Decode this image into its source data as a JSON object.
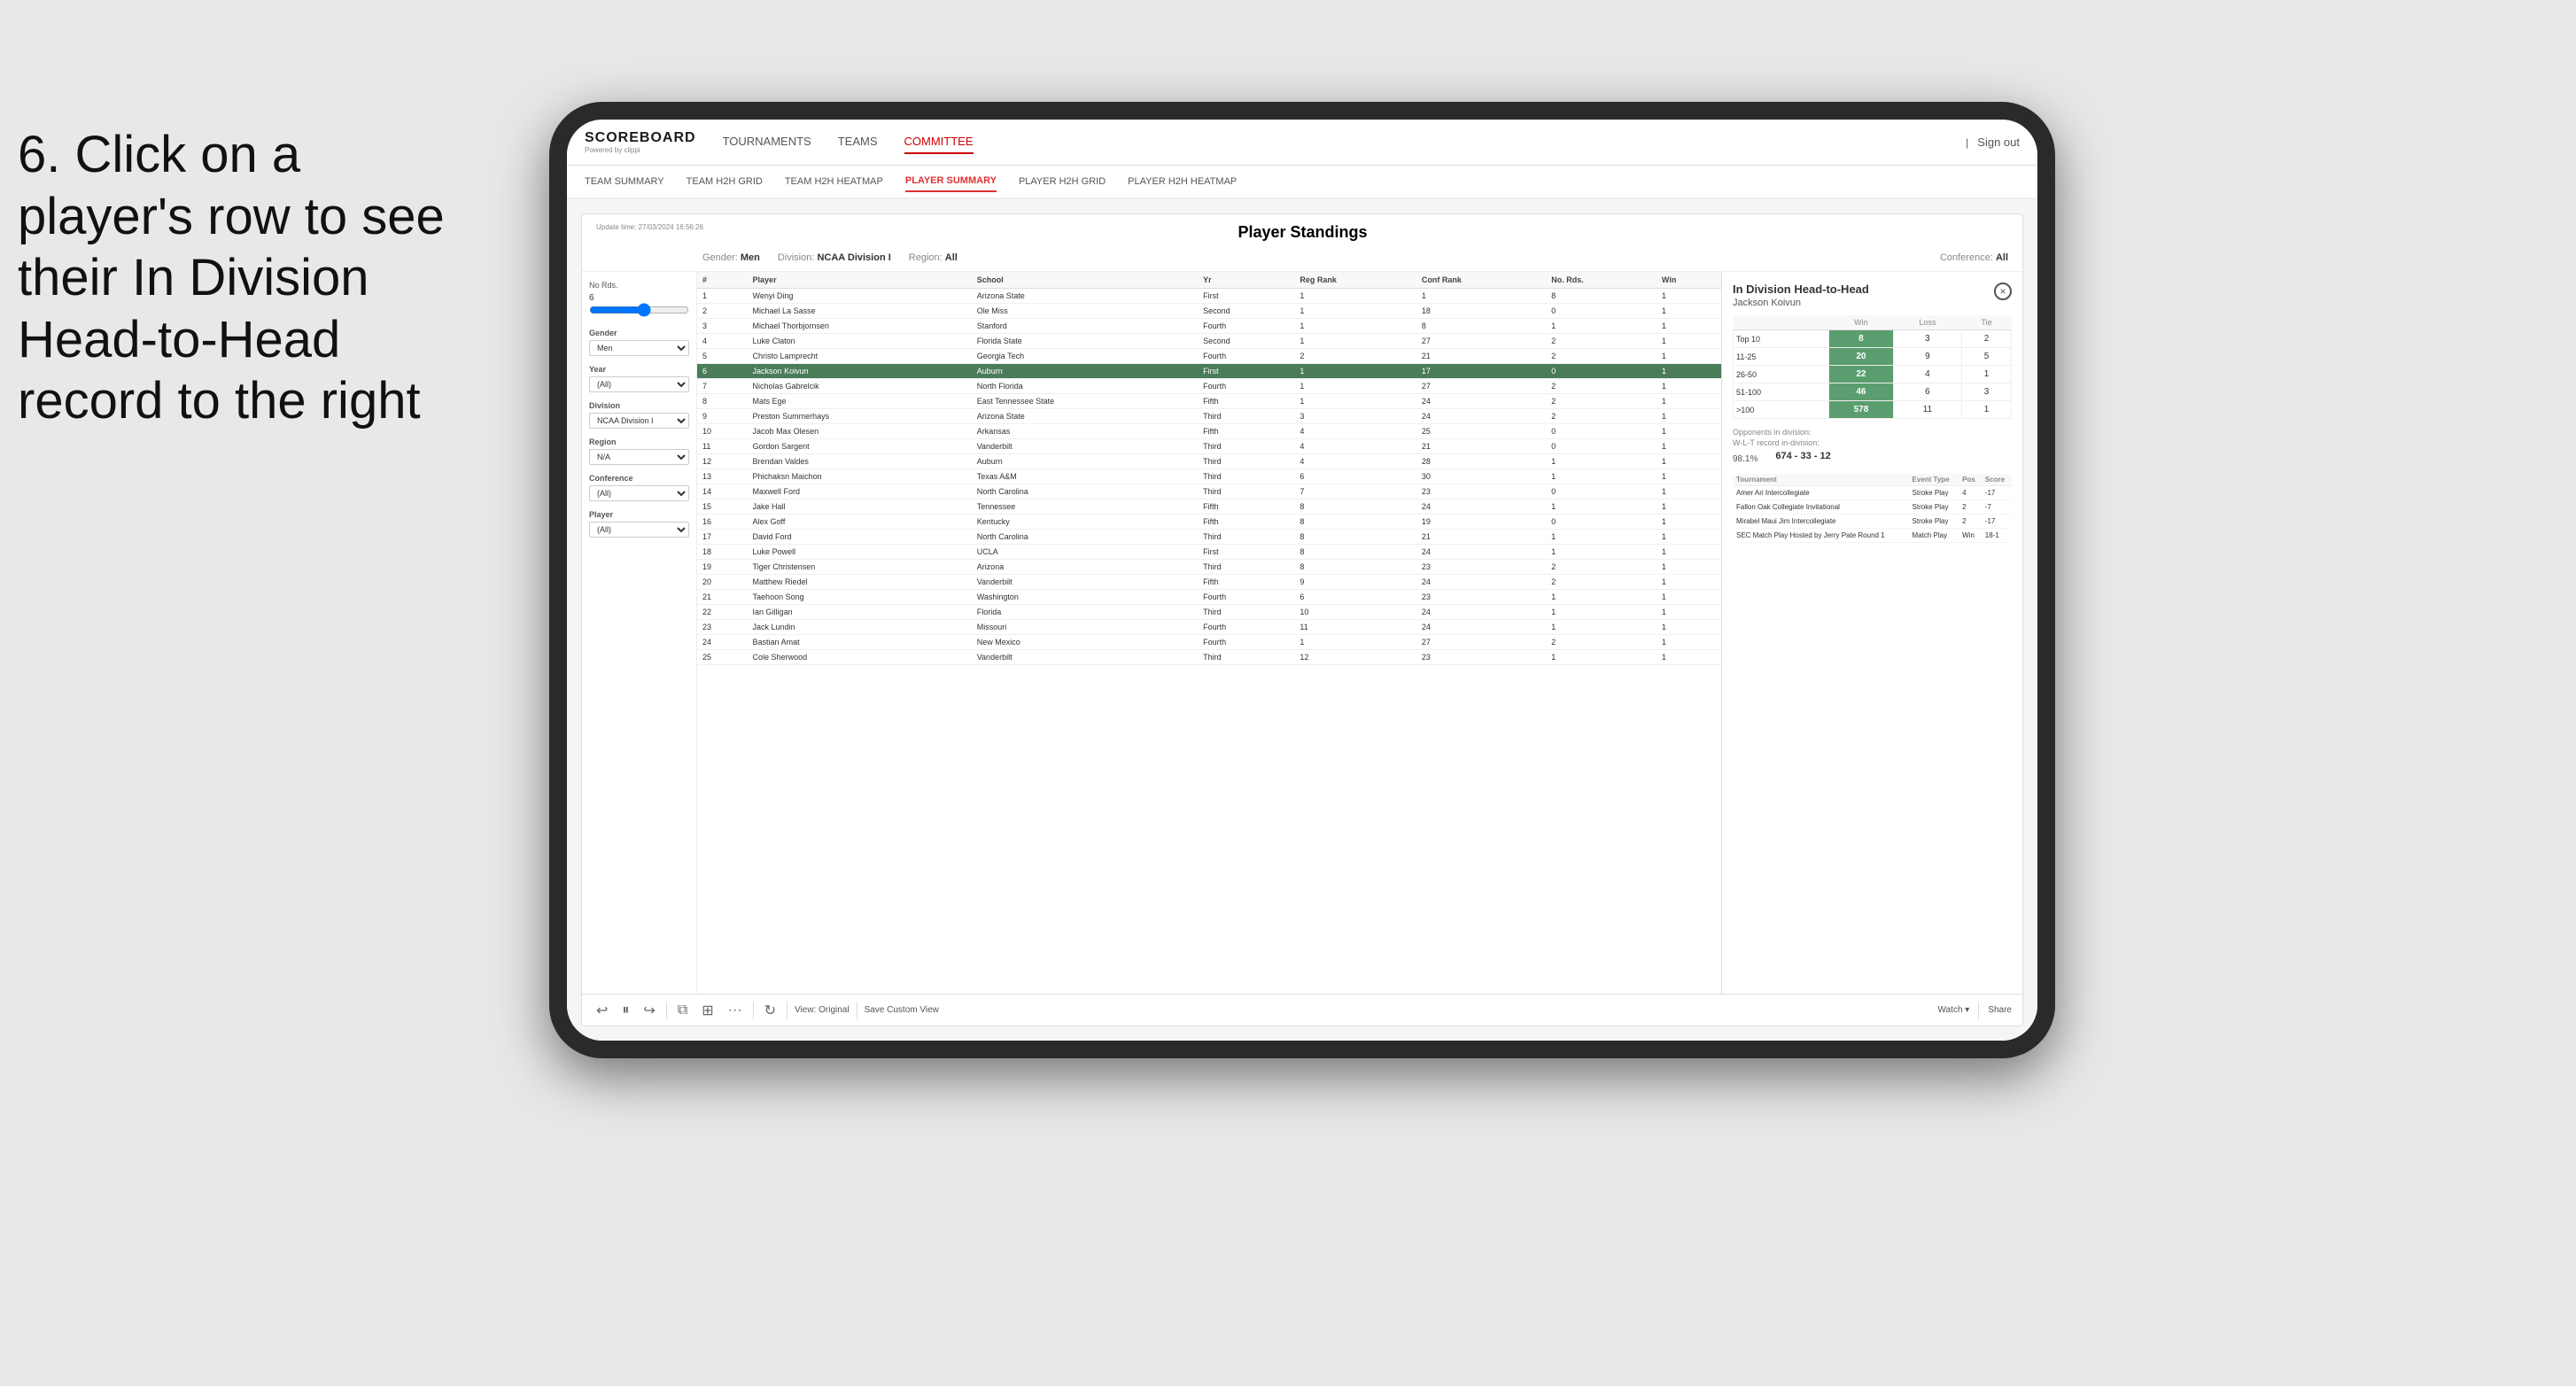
{
  "instruction": {
    "line1": "6. Click on a",
    "line2": "player's row to see",
    "line3": "their In Division",
    "line4": "Head-to-Head",
    "line5": "record to the right"
  },
  "nav": {
    "logo": "SCOREBOARD",
    "logo_sub": "Powered by clippi",
    "items": [
      "TOURNAMENTS",
      "TEAMS",
      "COMMITTEE"
    ],
    "sign_out": "Sign out"
  },
  "sub_nav": {
    "items": [
      "TEAM SUMMARY",
      "TEAM H2H GRID",
      "TEAM H2H HEATMAP",
      "PLAYER SUMMARY",
      "PLAYER H2H GRID",
      "PLAYER H2H HEATMAP"
    ]
  },
  "dashboard": {
    "update_time": "Update time:",
    "update_value": "27/03/2024 16:56:26",
    "title": "Player Standings",
    "filters": {
      "gender_label": "Gender:",
      "gender_value": "Men",
      "division_label": "Division:",
      "division_value": "NCAA Division I",
      "region_label": "Region:",
      "region_value": "All",
      "conference_label": "Conference:",
      "conference_value": "All"
    }
  },
  "sidebar": {
    "no_rds_label": "No Rds.",
    "no_rds_value": "6",
    "gender_label": "Gender",
    "gender_value": "Men",
    "year_label": "Year",
    "year_value": "(All)",
    "division_label": "Division",
    "division_value": "NCAA Division I",
    "region_label": "Region",
    "region_value": "N/A",
    "conference_label": "Conference",
    "conference_value": "(All)",
    "player_label": "Player",
    "player_value": "(All)"
  },
  "table": {
    "headers": [
      "#",
      "Player",
      "School",
      "Yr",
      "Reg Rank",
      "Conf Rank",
      "No. Rds.",
      "Win"
    ],
    "rows": [
      {
        "rank": 1,
        "player": "Wenyi Ding",
        "school": "Arizona State",
        "yr": "First",
        "reg": 1,
        "conf": 1,
        "rds": 8,
        "win": 1
      },
      {
        "rank": 2,
        "player": "Michael La Sasse",
        "school": "Ole Miss",
        "yr": "Second",
        "reg": 1,
        "conf": 18,
        "rds": 0,
        "win": 1
      },
      {
        "rank": 3,
        "player": "Michael Thorbjornsen",
        "school": "Stanford",
        "yr": "Fourth",
        "reg": 1,
        "conf": 8,
        "rds": 1,
        "win": 1
      },
      {
        "rank": 4,
        "player": "Luke Claton",
        "school": "Florida State",
        "yr": "Second",
        "reg": 1,
        "conf": 27,
        "rds": 2,
        "win": 1
      },
      {
        "rank": 5,
        "player": "Christo Lamprecht",
        "school": "Georgia Tech",
        "yr": "Fourth",
        "reg": 2,
        "conf": 21,
        "rds": 2,
        "win": 1
      },
      {
        "rank": 6,
        "player": "Jackson Koivun",
        "school": "Auburn",
        "yr": "First",
        "reg": 1,
        "conf": 17,
        "rds": 0,
        "win": 1,
        "selected": true
      },
      {
        "rank": 7,
        "player": "Nicholas Gabrelcik",
        "school": "North Florida",
        "yr": "Fourth",
        "reg": 1,
        "conf": 27,
        "rds": 2,
        "win": 1
      },
      {
        "rank": 8,
        "player": "Mats Ege",
        "school": "East Tennessee State",
        "yr": "Fifth",
        "reg": 1,
        "conf": 24,
        "rds": 2,
        "win": 1
      },
      {
        "rank": 9,
        "player": "Preston Summerhays",
        "school": "Arizona State",
        "yr": "Third",
        "reg": 3,
        "conf": 24,
        "rds": 2,
        "win": 1
      },
      {
        "rank": 10,
        "player": "Jacob Max Olesen",
        "school": "Arkansas",
        "yr": "Fifth",
        "reg": 4,
        "conf": 25,
        "rds": 0,
        "win": 1
      },
      {
        "rank": 11,
        "player": "Gordon Sargent",
        "school": "Vanderbilt",
        "yr": "Third",
        "reg": 4,
        "conf": 21,
        "rds": 0,
        "win": 1
      },
      {
        "rank": 12,
        "player": "Brendan Valdes",
        "school": "Auburn",
        "yr": "Third",
        "reg": 4,
        "conf": 28,
        "rds": 1,
        "win": 1
      },
      {
        "rank": 13,
        "player": "Phichaksn Maichon",
        "school": "Texas A&M",
        "yr": "Third",
        "reg": 6,
        "conf": 30,
        "rds": 1,
        "win": 1
      },
      {
        "rank": 14,
        "player": "Maxwell Ford",
        "school": "North Carolina",
        "yr": "Third",
        "reg": 7,
        "conf": 23,
        "rds": 0,
        "win": 1
      },
      {
        "rank": 15,
        "player": "Jake Hall",
        "school": "Tennessee",
        "yr": "Fifth",
        "reg": 8,
        "conf": 24,
        "rds": 1,
        "win": 1
      },
      {
        "rank": 16,
        "player": "Alex Goff",
        "school": "Kentucky",
        "yr": "Fifth",
        "reg": 8,
        "conf": 19,
        "rds": 0,
        "win": 1
      },
      {
        "rank": 17,
        "player": "David Ford",
        "school": "North Carolina",
        "yr": "Third",
        "reg": 8,
        "conf": 21,
        "rds": 1,
        "win": 1
      },
      {
        "rank": 18,
        "player": "Luke Powell",
        "school": "UCLA",
        "yr": "First",
        "reg": 8,
        "conf": 24,
        "rds": 1,
        "win": 1
      },
      {
        "rank": 19,
        "player": "Tiger Christensen",
        "school": "Arizona",
        "yr": "Third",
        "reg": 8,
        "conf": 23,
        "rds": 2,
        "win": 1
      },
      {
        "rank": 20,
        "player": "Matthew Riedel",
        "school": "Vanderbilt",
        "yr": "Fifth",
        "reg": 9,
        "conf": 24,
        "rds": 2,
        "win": 1
      },
      {
        "rank": 21,
        "player": "Taehoon Song",
        "school": "Washington",
        "yr": "Fourth",
        "reg": 6,
        "conf": 23,
        "rds": 1,
        "win": 1
      },
      {
        "rank": 22,
        "player": "Ian Gilligan",
        "school": "Florida",
        "yr": "Third",
        "reg": 10,
        "conf": 24,
        "rds": 1,
        "win": 1
      },
      {
        "rank": 23,
        "player": "Jack Lundin",
        "school": "Missouri",
        "yr": "Fourth",
        "reg": 11,
        "conf": 24,
        "rds": 1,
        "win": 1
      },
      {
        "rank": 24,
        "player": "Bastian Amat",
        "school": "New Mexico",
        "yr": "Fourth",
        "reg": 1,
        "conf": 27,
        "rds": 2,
        "win": 1
      },
      {
        "rank": 25,
        "player": "Cole Sherwood",
        "school": "Vanderbilt",
        "yr": "Third",
        "reg": 12,
        "conf": 23,
        "rds": 1,
        "win": 1
      }
    ]
  },
  "h2h_panel": {
    "title": "In Division Head-to-Head",
    "player_name": "Jackson Koivun",
    "close_label": "×",
    "table_headers": [
      "",
      "Win",
      "Loss",
      "Tie"
    ],
    "rows": [
      {
        "label": "Top 10",
        "win": 8,
        "loss": 3,
        "tie": 2
      },
      {
        "label": "11-25",
        "win": 20,
        "loss": 9,
        "tie": 5
      },
      {
        "label": "26-50",
        "win": 22,
        "loss": 4,
        "tie": 1
      },
      {
        "label": "51-100",
        "win": 46,
        "loss": 6,
        "tie": 3
      },
      {
        "label": ">100",
        "win": 578,
        "loss": 11,
        "tie": 1
      }
    ],
    "opponents_label": "Opponents in division:",
    "wl_label": "W-L-T record in-division:",
    "pct": "98.1%",
    "wl_record": "674 - 33 - 12",
    "tournament_headers": [
      "Tournament",
      "Event Type",
      "Pos",
      "Score"
    ],
    "tournaments": [
      {
        "name": "Amer Ari Intercollegiate",
        "type": "Stroke Play",
        "pos": 4,
        "score": -17
      },
      {
        "name": "Fallon Oak Collegiate Invitational",
        "type": "Stroke Play",
        "pos": 2,
        "score": -7
      },
      {
        "name": "Mirabel Maui Jim Intercollegiate",
        "type": "Stroke Play",
        "pos": 2,
        "score": -17
      },
      {
        "name": "SEC Match Play Hosted by Jerry Pate Round 1",
        "type": "Match Play",
        "pos": "Win",
        "score": "18-1"
      }
    ]
  },
  "toolbar": {
    "view_original": "View: Original",
    "save_custom": "Save Custom View",
    "watch": "Watch ▾",
    "share": "Share"
  }
}
